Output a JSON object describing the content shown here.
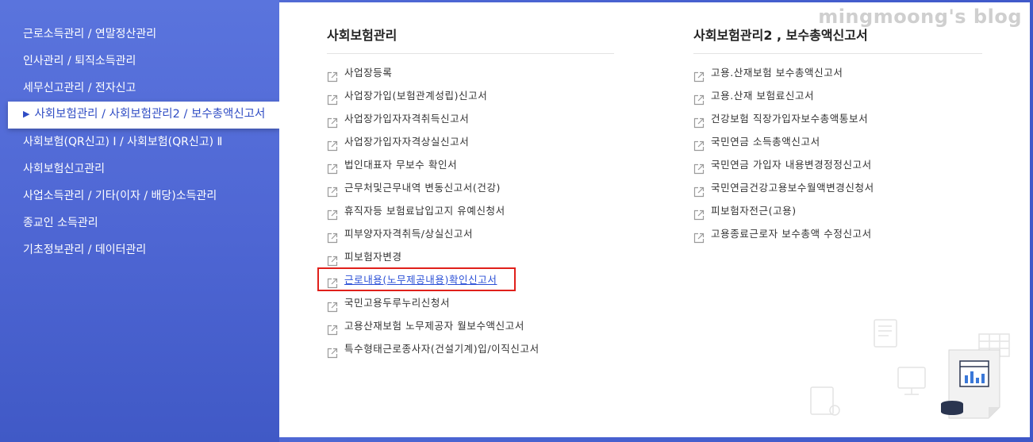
{
  "sidebar": {
    "items": [
      {
        "label": "근로소득관리 / 연말정산관리"
      },
      {
        "label": "인사관리 / 퇴직소득관리"
      },
      {
        "label": "세무신고관리 / 전자신고"
      },
      {
        "label": "사회보험관리 / 사회보험관리2 / 보수총액신고서",
        "active": true
      },
      {
        "label": "사회보험(QR신고) Ⅰ / 사회보험(QR신고) Ⅱ"
      },
      {
        "label": "사회보험신고관리"
      },
      {
        "label": "사업소득관리 / 기타(이자 / 배당)소득관리"
      },
      {
        "label": "종교인 소득관리"
      },
      {
        "label": "기초정보관리 / 데이터관리"
      }
    ]
  },
  "watermark": "mingmoong's blog",
  "col1": {
    "title": "사회보험관리",
    "items": [
      "사업장등록",
      "사업장가입(보험관계성립)신고서",
      "사업장가입자자격취득신고서",
      "사업장가입자자격상실신고서",
      "법인대표자 무보수 확인서",
      "근무처및근무내역 변동신고서(건강)",
      "휴직자등 보험료납입고지 유예신청서",
      "피부양자자격취득/상실신고서",
      "피보험자변경",
      "근로내용(노무제공내용)확인신고서",
      "국민고용두루누리신청서",
      "고용산재보험 노무제공자 월보수액신고서",
      "특수형태근로종사자(건설기계)입/이직신고서"
    ],
    "highlight_index": 9
  },
  "col2": {
    "title": "사회보험관리2 , 보수총액신고서",
    "items": [
      "고용.산재보험 보수총액신고서",
      "고용.산재 보험료신고서",
      "건강보험 직장가입자보수총액통보서",
      "국민연금 소득총액신고서",
      "국민연금 가입자 내용변경정정신고서",
      "국민연금건강고용보수월액변경신청서",
      "피보험자전근(고용)",
      "고용종료근로자 보수총액 수정신고서"
    ]
  },
  "colors": {
    "accent": "#3f5bcf",
    "highlight": "#e0201b",
    "link": "#2a4fd6"
  }
}
